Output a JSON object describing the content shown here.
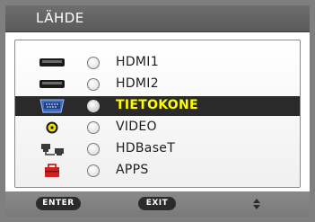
{
  "window": {
    "title": "LÄHDE"
  },
  "sources": [
    {
      "label": "HDMI1",
      "icon": "hdmi-port-icon",
      "selected": false
    },
    {
      "label": "HDMI2",
      "icon": "hdmi-port-icon",
      "selected": false
    },
    {
      "label": "TIETOKONE",
      "icon": "vga-port-icon",
      "selected": true
    },
    {
      "label": "VIDEO",
      "icon": "video-port-icon",
      "selected": false
    },
    {
      "label": "HDBaseT",
      "icon": "hdbaset-icon",
      "selected": false
    },
    {
      "label": "APPS",
      "icon": "apps-toolbox-icon",
      "selected": false
    }
  ],
  "footer": {
    "enter_label": "ENTER",
    "exit_label": "EXIT",
    "nav_icon": "up-down-arrows-icon"
  },
  "colors": {
    "selected_text": "#ffff00",
    "selected_row": "#2a2a2a",
    "frame": "#7f7f7f"
  }
}
